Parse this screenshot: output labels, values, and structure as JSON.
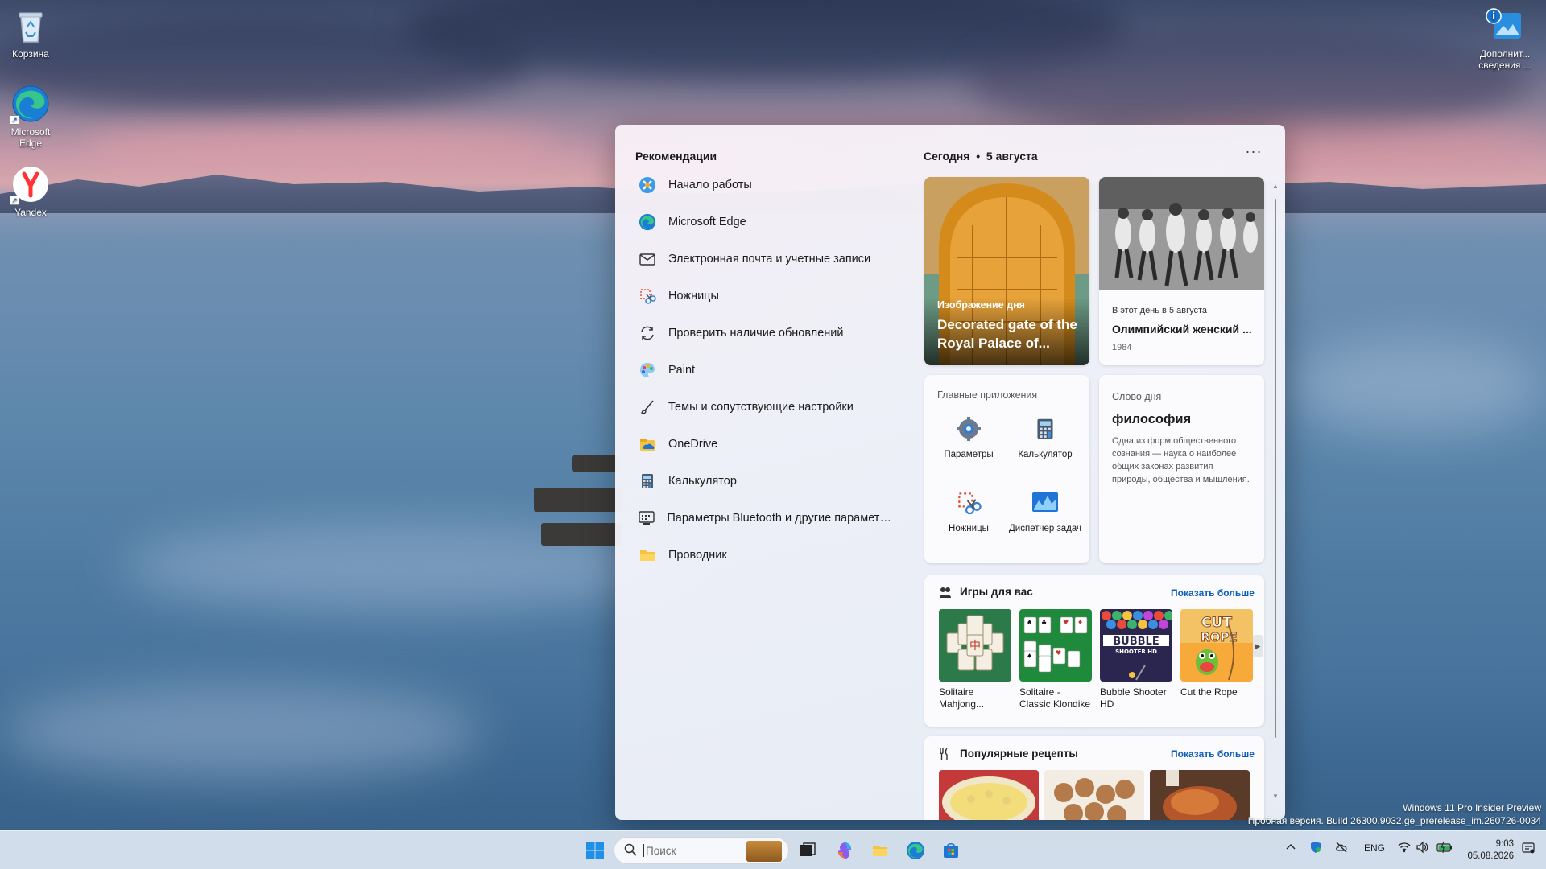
{
  "desktop": {
    "icons": [
      {
        "label": "Корзина"
      },
      {
        "label": "Microsoft Edge"
      },
      {
        "label": "Yandex"
      },
      {
        "label": "Дополнит... сведения ..."
      }
    ]
  },
  "widgets": {
    "recommendations_title": "Рекомендации",
    "recommendations": [
      {
        "label": "Начало работы",
        "icon": "get-started-icon"
      },
      {
        "label": "Microsoft Edge",
        "icon": "edge-icon"
      },
      {
        "label": "Электронная почта и учетные записи",
        "icon": "mail-icon"
      },
      {
        "label": "Ножницы",
        "icon": "snipping-tool-icon"
      },
      {
        "label": "Проверить наличие обновлений",
        "icon": "sync-icon"
      },
      {
        "label": "Paint",
        "icon": "paint-icon"
      },
      {
        "label": "Темы и сопутствующие настройки",
        "icon": "brush-icon"
      },
      {
        "label": "OneDrive",
        "icon": "onedrive-icon"
      },
      {
        "label": "Калькулятор",
        "icon": "calculator-icon"
      },
      {
        "label": "Параметры Bluetooth и другие параметры у...",
        "icon": "bluetooth-devices-icon"
      },
      {
        "label": "Проводник",
        "icon": "folder-icon"
      }
    ],
    "today_label": "Сегодня",
    "today_date": "5 августа",
    "more_label": "···",
    "image_of_day": {
      "tag": "Изображение дня",
      "title": "Decorated gate of the Royal Palace of..."
    },
    "this_day": {
      "tag": "В этот день в 5 августа",
      "title": "Олимпийский женский ...",
      "year": "1984"
    },
    "top_apps": {
      "title": "Главные приложения",
      "apps": [
        {
          "label": "Параметры",
          "icon": "settings-gear-icon"
        },
        {
          "label": "Калькулятор",
          "icon": "calculator-icon"
        },
        {
          "label": "Ножницы",
          "icon": "snipping-tool-icon"
        },
        {
          "label": "Диспетчер задач",
          "icon": "task-manager-icon"
        }
      ]
    },
    "word_of_day": {
      "title": "Слово дня",
      "word": "философия",
      "definition": "Одна из форм общественного сознания — наука о наиболее общих законах развития природы, общества и мышления."
    },
    "games": {
      "title": "Игры для вас",
      "more": "Показать больше",
      "items": [
        {
          "label": "Solitaire Mahjong..."
        },
        {
          "label": "Solitaire - Classic Klondike"
        },
        {
          "label": "Bubble Shooter HD"
        },
        {
          "label": "Cut the Rope"
        }
      ]
    },
    "recipes": {
      "title": "Популярные рецепты",
      "more": "Показать больше"
    }
  },
  "watermark": {
    "line1": "Windows 11 Pro Insider Preview",
    "line2": "Пробная версия. Build 26300.9032.ge_prerelease_im.260726-0034"
  },
  "taskbar": {
    "search_placeholder": "Поиск",
    "language": "ENG",
    "time": "9:03",
    "date": "05.08.2026"
  },
  "colors": {
    "accent": "#0f5fb8",
    "taskbar": "#e0e8f3"
  }
}
